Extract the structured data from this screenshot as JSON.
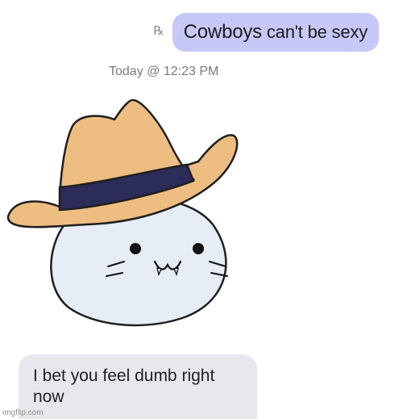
{
  "sent_message": {
    "read_icon": "read-receipt-icon",
    "word_1": "Cowboys",
    "word_2": " can't be sexy",
    "bubble_color": "#c6c8f8"
  },
  "timestamp": "Today @ 12:23 PM",
  "received_message": {
    "line_1": "I bet you feel dumb right",
    "line_2": "now",
    "bubble_color": "#e7e7ed"
  },
  "image": {
    "subject": "seal-in-cowboy-hat",
    "hat_color": "#eebd82",
    "band_color": "#2b2c58",
    "body_color": "#e6edf7"
  },
  "watermark": "imgflip.com"
}
